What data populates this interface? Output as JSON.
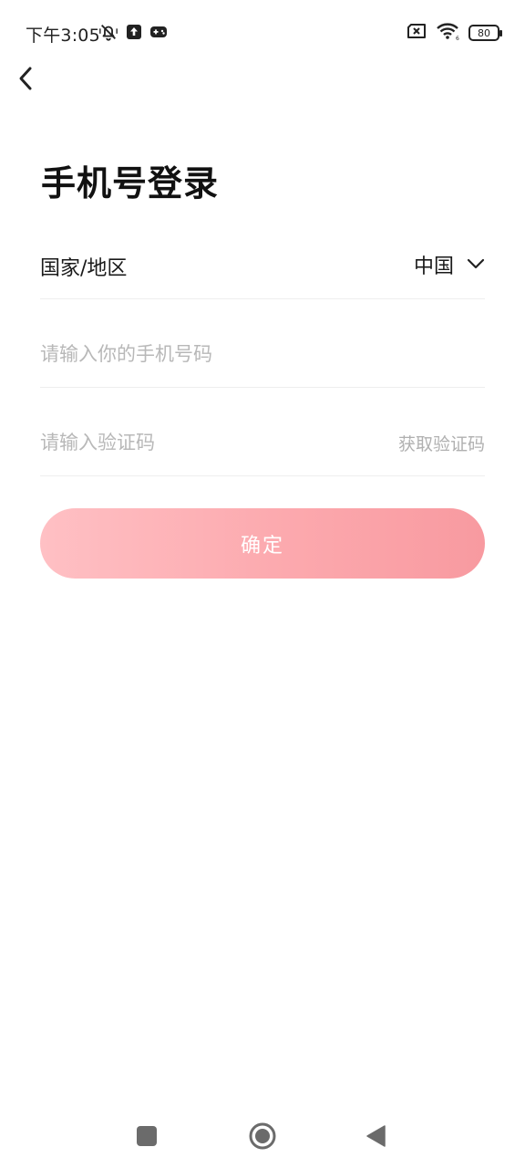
{
  "status_bar": {
    "time": "下午3:05",
    "battery": "80",
    "left_icons": [
      "bell-muted-icon",
      "upload-icon",
      "gamepad-icon"
    ],
    "right_icons": [
      "sim-off-icon",
      "wifi-icon",
      "battery-icon"
    ]
  },
  "header": {
    "back_icon": "chevron-left-icon"
  },
  "title": "手机号登录",
  "form": {
    "country_label": "国家/地区",
    "country_value": "中国",
    "phone_placeholder": "请输入你的手机号码",
    "phone_value": "",
    "code_placeholder": "请输入验证码",
    "code_value": "",
    "get_code_label": "获取验证码"
  },
  "confirm_label": "确定",
  "colors": {
    "button_gradient_start": "#ffc0c4",
    "button_gradient_end": "#f89aa0",
    "placeholder": "#b8b8b8",
    "divider": "#eeeeee"
  },
  "nav": {
    "icons": [
      "recents-square-icon",
      "home-circle-icon",
      "back-triangle-icon"
    ]
  }
}
